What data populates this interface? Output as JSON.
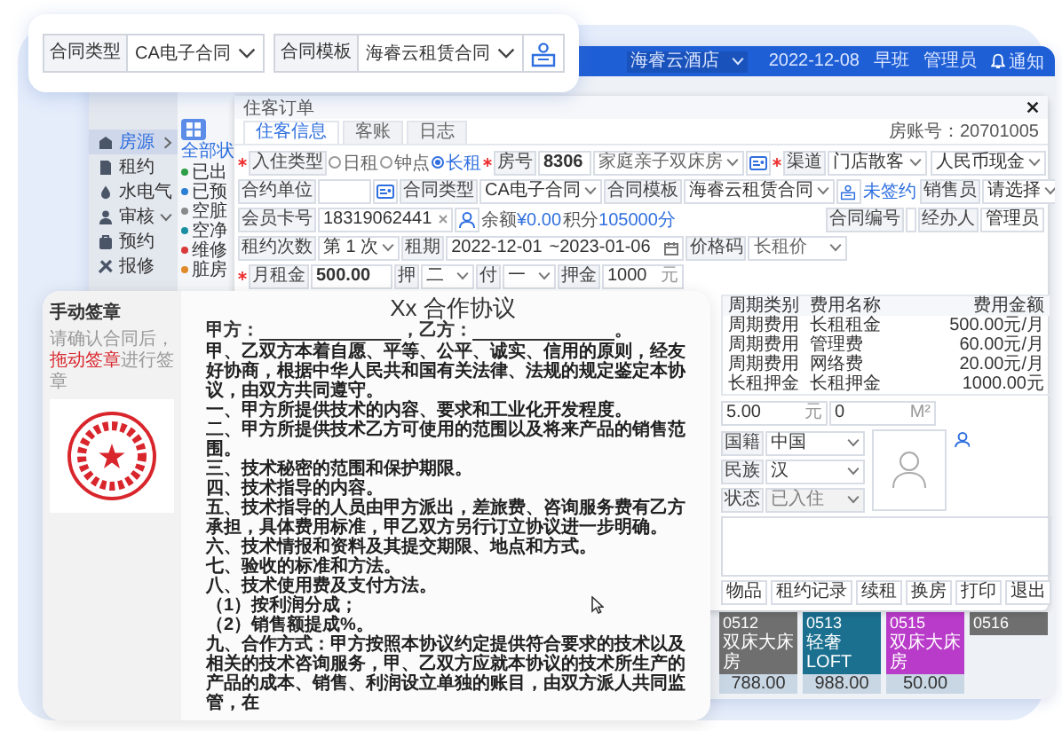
{
  "callout": {
    "fields": [
      {
        "label": "合同类型",
        "value": "CA电子合同"
      },
      {
        "label": "合同模板",
        "value": "海睿云租赁合同"
      }
    ]
  },
  "topbar": {
    "hotel": "海睿云酒店",
    "date": "2022-12-08",
    "shift": "早班",
    "user": "管理员",
    "notice": "通知"
  },
  "sidebar": {
    "items": [
      {
        "label": "房源",
        "kind": "group",
        "expanded": false,
        "selected": true
      },
      {
        "label": "租约",
        "kind": "link",
        "expanded": false,
        "selected": false
      },
      {
        "label": "水电气",
        "kind": "link",
        "expanded": false,
        "selected": false
      },
      {
        "label": "审核",
        "kind": "group",
        "expanded": true,
        "selected": false
      },
      {
        "label": "预约",
        "kind": "link",
        "expanded": false,
        "selected": false
      },
      {
        "label": "报修",
        "kind": "link",
        "expanded": false,
        "selected": false
      }
    ]
  },
  "status_list": {
    "header": "全部状",
    "items": [
      {
        "label": "已出",
        "color": "#2e9e47"
      },
      {
        "label": "已预",
        "color": "#2a7fd4"
      },
      {
        "label": "空脏",
        "color": "#8a8a8a"
      },
      {
        "label": "空净",
        "color": "#1a8fa0"
      },
      {
        "label": "维修",
        "color": "#d93a3a"
      },
      {
        "label": "脏房",
        "color": "#e08a2a"
      }
    ]
  },
  "dialog": {
    "title": "住客订单",
    "tabs": [
      {
        "label": "住客信息",
        "selected": true
      },
      {
        "label": "客账",
        "selected": false
      },
      {
        "label": "日志",
        "selected": false
      }
    ],
    "order_no": "房账号：20701005",
    "stay_type": {
      "label": "入住类型",
      "required": true,
      "options": [
        {
          "label": "日租",
          "selected": false
        },
        {
          "label": "钟点",
          "selected": false
        },
        {
          "label": "长租",
          "selected": true
        }
      ]
    },
    "room": {
      "label": "房号",
      "required": true,
      "value": "8306"
    },
    "room_type": {
      "value": "家庭亲子双床房"
    },
    "channel": {
      "label": "渠道",
      "required": true,
      "value": "门店散客"
    },
    "payment": {
      "value": "人民币现金"
    },
    "contract_unit": {
      "label": "合约单位"
    },
    "contract_type": {
      "label": "合同类型",
      "value": "CA电子合同"
    },
    "contract_template": {
      "label": "合同模板",
      "value": "海睿云租赁合同"
    },
    "sign_status": "未签约",
    "sales": {
      "label": "销售员",
      "value": "请选择"
    },
    "member": {
      "label": "会员卡号",
      "value": "18319062441"
    },
    "balance": {
      "label": "余额",
      "value": "¥0.00"
    },
    "points": {
      "label": "积分",
      "value": "105000分"
    },
    "contract_no": {
      "label": "合同编号"
    },
    "handler": {
      "label": "经办人",
      "value": "管理员"
    },
    "lease_count": {
      "label": "租约次数",
      "value": "第 1 次"
    },
    "term": {
      "label": "租期",
      "start": "2022-12-01",
      "end": "~2023-01-06"
    },
    "price_code": {
      "label": "价格码",
      "value": "长租价"
    },
    "rent": {
      "label": "月租金",
      "required": true,
      "value": "500.00"
    },
    "deposit_months": {
      "label": "押",
      "value": "二"
    },
    "pay_months": {
      "label": "付",
      "value": "一"
    },
    "deposit": {
      "label": "押金",
      "value": "1000",
      "unit": "元"
    },
    "fee_table": {
      "columns": [
        "周期类别",
        "费用名称",
        "费用金额"
      ],
      "rows": [
        [
          "周期费用",
          "长租租金",
          "500.00元/月"
        ],
        [
          "周期费用",
          "管理费",
          "60.00元/月"
        ],
        [
          "周期费用",
          "网络费",
          "20.00元/月"
        ],
        [
          "长租押金",
          "长租押金",
          "1000.00元"
        ]
      ]
    },
    "extra_fields": [
      {
        "value": "5.00",
        "unit": "元"
      },
      {
        "value": "0",
        "unit": "M²"
      }
    ],
    "profile": [
      {
        "label": "国籍",
        "value": "中国",
        "disabled": false
      },
      {
        "label": "民族",
        "value": "汉",
        "disabled": false
      },
      {
        "label": "状态",
        "value": "已入住",
        "disabled": true
      }
    ],
    "buttons": [
      "物品",
      "租约记录",
      "续租",
      "换房",
      "打印",
      "退出"
    ]
  },
  "rooms": [
    {
      "number": "0512",
      "type": "双床大床房",
      "price": "788.00",
      "color": "#6f6f6f"
    },
    {
      "number": "0513",
      "type": "轻奢LOFT",
      "price": "988.00",
      "color": "#1b6f8f"
    },
    {
      "number": "0515",
      "type": "双床大床房",
      "price": "50.00",
      "color": "#b93bc9"
    },
    {
      "number": "0516",
      "color": "#6f6f6f"
    }
  ],
  "contract_panel": {
    "title": "手动签章",
    "hint": [
      {
        "text": "请确认合同后，",
        "kind": "plain"
      },
      {
        "text": "拖动签章",
        "kind": "highlight"
      },
      {
        "text": "进行签章",
        "kind": "plain"
      }
    ],
    "document": {
      "title": "Xx 合作协议",
      "parties": [
        "甲方：",
        "，乙方：",
        "。"
      ],
      "paragraphs": [
        "甲、乙双方本着自愿、平等、公平、诚实、信用的原则，经友好协商，根据中华人民共和国有关法律、法规的规定鉴定本协议，由双方共同遵守。",
        "一、甲方所提供技术的内容、要求和工业化开发程度。",
        "二、甲方所提供技术乙方可使用的范围以及将来产品的销售范围。",
        "三、技术秘密的范围和保护期限。",
        "四、技术指导的内容。",
        "五、技术指导的人员由甲方派出，差旅费、咨询服务费有乙方承担，具体费用标准，甲乙双方另行订立协议进一步明确。",
        "六、技术情报和资料及其提交期限、地点和方式。",
        "七、验收的标准和方法。",
        "八、技术使用费及支付方法。",
        "（1）按利润分成；",
        "（2）销售额提成%。",
        "九、合作方式：甲方按照本协议约定提供符合要求的技术以及相关的技术咨询服务，甲、乙双方应就本协议的技术所生产的产品的成本、销售、利润设立单独的账目，由双方派人共同监管，在"
      ]
    }
  }
}
